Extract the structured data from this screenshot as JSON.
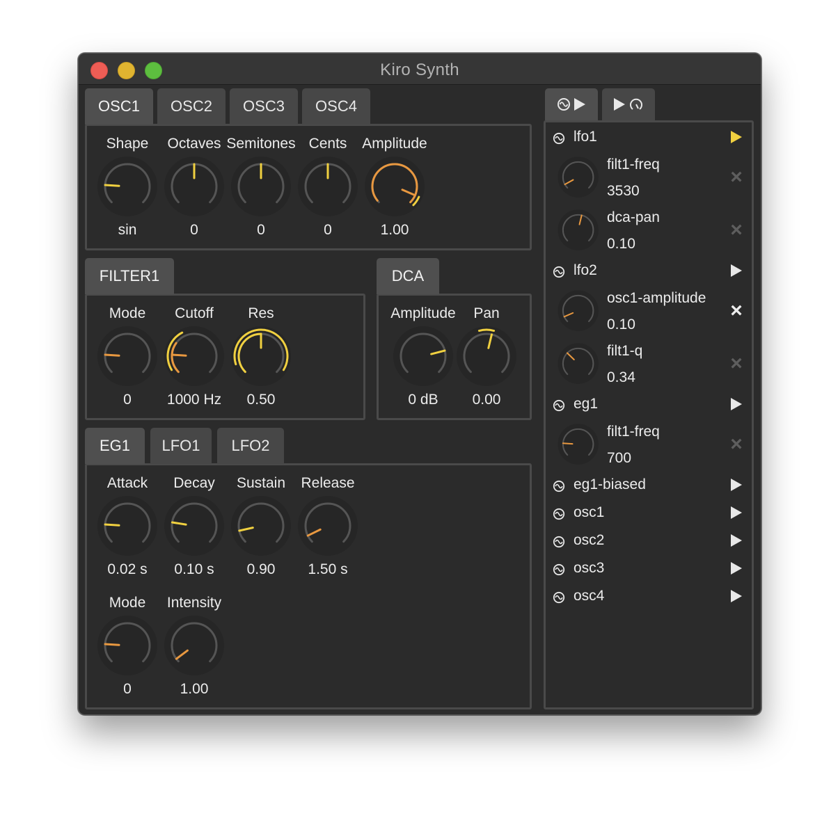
{
  "window": {
    "title": "Kiro Synth"
  },
  "colors": {
    "accent": "#f0d040",
    "accent2": "#e89840",
    "knob_body": "#262626",
    "knob_track": "#555555",
    "bg": "#2b2b2b"
  },
  "osc": {
    "tabs": [
      "OSC1",
      "OSC2",
      "OSC3",
      "OSC4"
    ],
    "active_tab": 0,
    "knobs": [
      {
        "label": "Shape",
        "value": "sin",
        "norm": 0.18,
        "color": "#f0d040"
      },
      {
        "label": "Octaves",
        "value": "0",
        "norm": 0.5,
        "color": "#f0d040"
      },
      {
        "label": "Semitones",
        "value": "0",
        "norm": 0.5,
        "color": "#f0d040"
      },
      {
        "label": "Cents",
        "value": "0",
        "norm": 0.5,
        "color": "#f0d040"
      },
      {
        "label": "Amplitude",
        "value": "1.00",
        "norm": 0.92,
        "color": "#e89840",
        "arc": [
          0.02,
          1.0
        ],
        "mod": [
          0.92,
          1.0
        ]
      }
    ]
  },
  "filter": {
    "tab": "FILTER1",
    "knobs": [
      {
        "label": "Mode",
        "value": "0",
        "norm": 0.18,
        "color": "#e89840"
      },
      {
        "label": "Cutoff",
        "value": "1000 Hz",
        "norm": 0.18,
        "color": "#e89840",
        "arc": [
          0.0,
          0.3
        ],
        "mod": [
          0.05,
          0.4
        ]
      },
      {
        "label": "Res",
        "value": "0.50",
        "norm": 0.5,
        "color": "#f0d040",
        "arc": [
          0.0,
          0.5
        ],
        "mod": [
          0.1,
          0.95
        ]
      }
    ]
  },
  "dca": {
    "tab": "DCA",
    "knobs": [
      {
        "label": "Amplitude",
        "value": "0 dB",
        "norm": 0.78,
        "color": "#f0d040"
      },
      {
        "label": "Pan",
        "value": "0.00",
        "norm": 0.55,
        "color": "#f0d040",
        "mod": [
          0.44,
          0.56
        ]
      }
    ]
  },
  "env": {
    "tabs": [
      "EG1",
      "LFO1",
      "LFO2"
    ],
    "active_tab": 0,
    "knobs": [
      {
        "label": "Attack",
        "value": "0.02 s",
        "norm": 0.18,
        "color": "#f0d040"
      },
      {
        "label": "Decay",
        "value": "0.10 s",
        "norm": 0.2,
        "color": "#f0d040"
      },
      {
        "label": "Sustain",
        "value": "0.90",
        "norm": 0.12,
        "color": "#f0d040"
      },
      {
        "label": "Release",
        "value": "1.50 s",
        "norm": 0.07,
        "color": "#e89840"
      },
      {
        "label": "Mode",
        "value": "0",
        "norm": 0.18,
        "color": "#e89840"
      },
      {
        "label": "Intensity",
        "value": "1.00",
        "norm": 0.03,
        "color": "#e89840"
      }
    ]
  },
  "modulation": {
    "tabs": [
      "source-play",
      "play-target"
    ],
    "sources": [
      {
        "name": "lfo1",
        "active": true,
        "targets": [
          {
            "name": "filt1-freq",
            "value": "3530",
            "norm": 0.06,
            "color": "#e89840",
            "x_active": false
          },
          {
            "name": "dca-pan",
            "value": "0.10",
            "norm": 0.55,
            "color": "#e89840",
            "x_active": false
          }
        ]
      },
      {
        "name": "lfo2",
        "active": false,
        "targets": [
          {
            "name": "osc1-amplitude",
            "value": "0.10",
            "norm": 0.08,
            "color": "#e89840",
            "x_active": true
          },
          {
            "name": "filt1-q",
            "value": "0.34",
            "norm": 0.33,
            "color": "#e89840",
            "x_active": false
          }
        ]
      },
      {
        "name": "eg1",
        "active": false,
        "targets": [
          {
            "name": "filt1-freq",
            "value": "700",
            "norm": 0.18,
            "color": "#e89840",
            "x_active": false
          }
        ]
      },
      {
        "name": "eg1-biased",
        "active": false,
        "targets": []
      },
      {
        "name": "osc1",
        "active": false,
        "targets": []
      },
      {
        "name": "osc2",
        "active": false,
        "targets": []
      },
      {
        "name": "osc3",
        "active": false,
        "targets": []
      },
      {
        "name": "osc4",
        "active": false,
        "targets": []
      }
    ]
  }
}
